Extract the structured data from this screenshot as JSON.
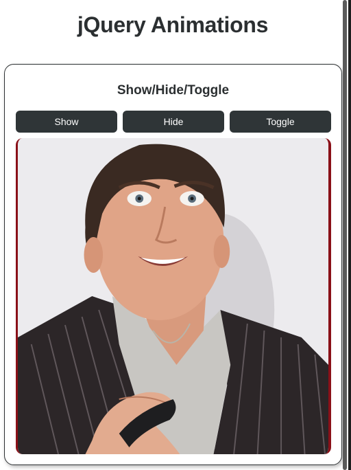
{
  "page": {
    "title": "jQuery Animations"
  },
  "card": {
    "title": "Show/Hide/Toggle",
    "buttons": {
      "show": "Show",
      "hide": "Hide",
      "toggle": "Toggle"
    },
    "image": {
      "alt": "Portrait of a smiling man in a pinstripe suit"
    }
  },
  "colors": {
    "button_bg": "#2f3537",
    "text": "#2b2f31",
    "image_border": "#8a1018"
  }
}
